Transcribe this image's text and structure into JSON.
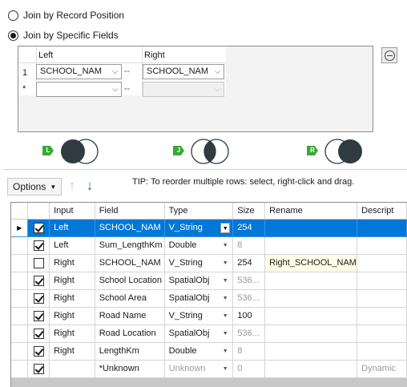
{
  "radios": {
    "by_position": "Join by Record Position",
    "by_fields": "Join by Specific Fields"
  },
  "join_fields": {
    "left_header": "Left",
    "right_header": "Right",
    "rows": [
      {
        "num": "1",
        "left": "SCHOOL_NAM",
        "right": "SCHOOL_NAM"
      },
      {
        "num": "*",
        "left": "",
        "right": ""
      }
    ]
  },
  "venn": {
    "left_badge": "L",
    "join_badge": "J",
    "right_badge": "R"
  },
  "toolbar": {
    "options_label": "Options",
    "tip": "TIP: To reorder multiple rows: select, right-click and drag."
  },
  "grid": {
    "columns": [
      "Input",
      "Field",
      "Type",
      "Size",
      "Rename",
      "Descript"
    ],
    "rows": [
      {
        "checked": true,
        "input": "Left",
        "field": "SCHOOL_NAM",
        "type": "V_String",
        "size": "254",
        "rename": "",
        "desc": ""
      },
      {
        "checked": true,
        "input": "Left",
        "field": "Sum_LengthKm",
        "type": "Double",
        "size": "8",
        "rename": "",
        "desc": ""
      },
      {
        "checked": false,
        "input": "Right",
        "field": "SCHOOL_NAM",
        "type": "V_String",
        "size": "254",
        "rename": "Right_SCHOOL_NAM",
        "desc": ""
      },
      {
        "checked": true,
        "input": "Right",
        "field": "School Location",
        "type": "SpatialObj",
        "size": "536...",
        "rename": "",
        "desc": ""
      },
      {
        "checked": true,
        "input": "Right",
        "field": "School Area",
        "type": "SpatialObj",
        "size": "536...",
        "rename": "",
        "desc": ""
      },
      {
        "checked": true,
        "input": "Right",
        "field": "Road Name",
        "type": "V_String",
        "size": "100",
        "rename": "",
        "desc": ""
      },
      {
        "checked": true,
        "input": "Right",
        "field": "Road Location",
        "type": "SpatialObj",
        "size": "536...",
        "rename": "",
        "desc": ""
      },
      {
        "checked": true,
        "input": "Right",
        "field": "LengthKm",
        "type": "Double",
        "size": "8",
        "rename": "",
        "desc": ""
      },
      {
        "checked": true,
        "input": "",
        "field": "*Unknown",
        "type": "Unknown",
        "size": "0",
        "rename": "",
        "desc": "Dynamic"
      }
    ]
  },
  "colors": {
    "selection": "#0078d7",
    "venn_fill": "#2f3b40",
    "badge_green": "#39a935"
  }
}
